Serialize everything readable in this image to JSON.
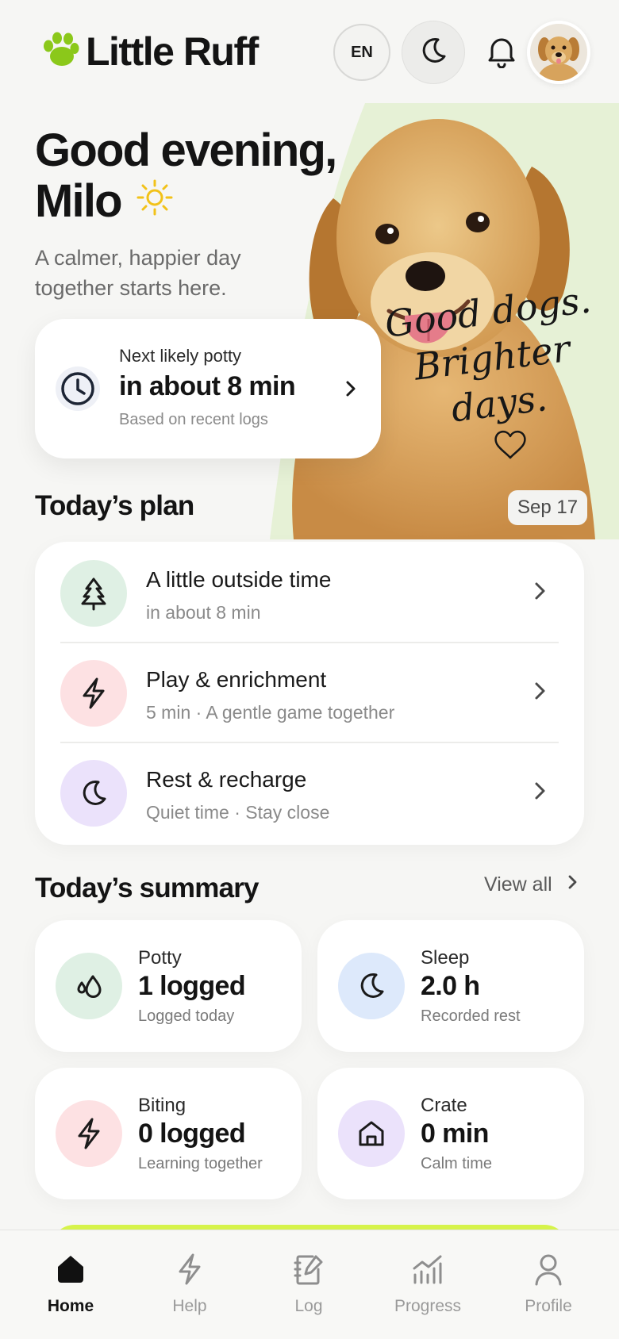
{
  "app": {
    "title": "Little Ruff",
    "accent_color": "#8bc81a",
    "logo_icon": "paw-icon"
  },
  "header": {
    "language_label": "EN",
    "theme_icon": "moon-icon",
    "notifications_icon": "bell-icon",
    "avatar_icon": "puppy-avatar"
  },
  "hero": {
    "greeting_line1": "Good evening,",
    "greeting_name": "Milo",
    "greeting_icon": "sun-icon",
    "tagline": "A calmer, happier day together starts here.",
    "art_text": [
      "Good dogs.",
      "Brighter",
      "days."
    ],
    "art_icon": "heart-icon"
  },
  "potty_card": {
    "label": "Next likely potty",
    "value": "in about 8 min",
    "note": "Based on recent logs",
    "icon": "clock-icon"
  },
  "plan": {
    "title": "Today’s plan",
    "date": "Sep 17",
    "items": [
      {
        "title": "A little outside time",
        "subtitle": "in about 8 min",
        "icon": "tree-icon",
        "color": "#dff0e4"
      },
      {
        "title": "Play & enrichment",
        "subtitle": "5 min · A gentle game together",
        "icon": "bolt-icon",
        "color": "#fde1e3"
      },
      {
        "title": "Rest & recharge",
        "subtitle": "Quiet time · Stay close",
        "icon": "moon-icon",
        "color": "#ebe2fb"
      }
    ]
  },
  "summary": {
    "title": "Today’s summary",
    "view_all": "View all",
    "cards": [
      {
        "label": "Potty",
        "value": "1 logged",
        "note": "Logged today",
        "icon": "drops-icon",
        "color": "#dff0e4"
      },
      {
        "label": "Sleep",
        "value": "2.0 h",
        "note": "Recorded rest",
        "icon": "moon-icon",
        "color": "#dde9fb"
      },
      {
        "label": "Biting",
        "value": "0 logged",
        "note": "Learning together",
        "icon": "bolt-icon",
        "color": "#fde1e3"
      },
      {
        "label": "Crate",
        "value": "0 min",
        "note": "Calm time",
        "icon": "house-icon",
        "color": "#ebe2fb"
      }
    ]
  },
  "nav": {
    "items": [
      {
        "label": "Home",
        "icon": "home-icon",
        "active": true
      },
      {
        "label": "Help",
        "icon": "bolt-icon",
        "active": false
      },
      {
        "label": "Log",
        "icon": "notebook-icon",
        "active": false
      },
      {
        "label": "Progress",
        "icon": "chart-icon",
        "active": false
      },
      {
        "label": "Profile",
        "icon": "user-icon",
        "active": false
      }
    ]
  }
}
